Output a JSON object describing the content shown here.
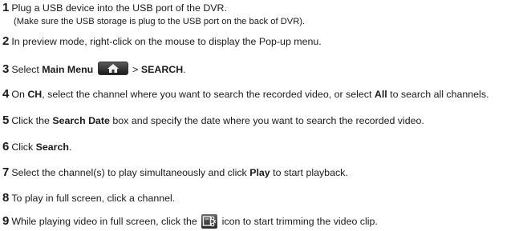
{
  "steps": [
    {
      "num": "1",
      "text": "Plug a USB device into the USB port of the DVR."
    },
    {
      "num": "2",
      "text": "In preview mode, right-click on the mouse to display the Pop-up menu."
    },
    {
      "num": "3",
      "pre": "Select ",
      "bold1": "Main Menu",
      "mid": " > ",
      "bold2": "SEARCH",
      "post": "."
    },
    {
      "num": "4",
      "pre": "On ",
      "bold1": "CH",
      "mid": ", select the channel where you want to search the recorded video, or select ",
      "bold2": "All",
      "post": " to search all channels."
    },
    {
      "num": "5",
      "pre": "Click the ",
      "bold1": "Search Date",
      "post": " box and specify the date where you want to search the recorded video."
    },
    {
      "num": "6",
      "pre": "Click ",
      "bold1": "Search",
      "post": "."
    },
    {
      "num": "7",
      "pre": "Select the channel(s) to play simultaneously and click ",
      "bold1": "Play",
      "post": " to start playback."
    },
    {
      "num": "8",
      "text": "To play in full screen, click a channel."
    },
    {
      "num": "9",
      "pre": "While playing video in full screen, click the ",
      "post": " icon to start trimming the video clip."
    }
  ],
  "note": "(Make sure the USB storage is plug to the USB port on the back of DVR).",
  "icons": {
    "home": "home-icon",
    "trim": "trim-icon"
  }
}
